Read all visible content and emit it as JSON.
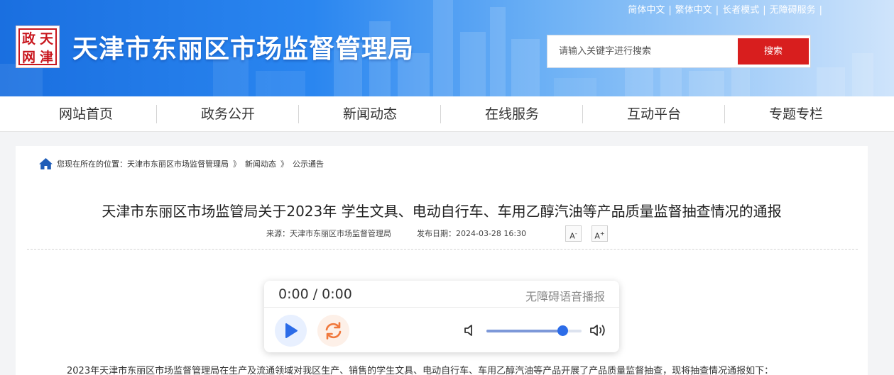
{
  "header": {
    "top_links": [
      "简体中文",
      "繁体中文",
      "长者模式",
      "无障碍服务"
    ],
    "separator": "|",
    "logo_chars": [
      "天",
      "津",
      "政",
      "网"
    ],
    "site_title": "天津市东丽区市场监督管理局",
    "search": {
      "placeholder": "请输入关键字进行搜索",
      "button": "搜索"
    },
    "colors": {
      "banner_start": "#1a6fe0",
      "banner_end": "#cfe4fb",
      "search_button": "#d81e1e",
      "logo_red": "#c8161d"
    }
  },
  "nav": {
    "items": [
      {
        "label": "网站首页"
      },
      {
        "label": "政务公开"
      },
      {
        "label": "新闻动态"
      },
      {
        "label": "在线服务"
      },
      {
        "label": "互动平台"
      },
      {
        "label": "专题专栏"
      }
    ]
  },
  "breadcrumb": {
    "icon": "home-icon",
    "prefix": "您现在所在的位置：",
    "items": [
      "天津市东丽区市场监督管理局",
      "新闻动态",
      "公示通告"
    ],
    "arrow": "》"
  },
  "article": {
    "title": "天津市东丽区市场监管局关于2023年 学生文具、电动自行车、车用乙醇汽油等产品质量监督抽查情况的通报",
    "source": "来源：天津市东丽区市场监督管理局",
    "date": "发布日期：2024-03-28 16:30",
    "font_decrease": {
      "letter": "A",
      "sign": "-"
    },
    "font_increase": {
      "letter": "A",
      "sign": "+"
    },
    "body_first_line": "2023年天津市东丽区市场监督管理局在生产及流通领域对我区生产、销售的学生文具、电动自行车、车用乙醇汽油等产品开展了产品质量监督抽查，现将抽查情况通报如下："
  },
  "player": {
    "time": "0:00 / 0:00",
    "label": "无障碍语音播报",
    "volume": 0.8,
    "colors": {
      "play": "#2c6ce8",
      "loop": "#f0783c",
      "knob": "#2c6ce8"
    }
  }
}
